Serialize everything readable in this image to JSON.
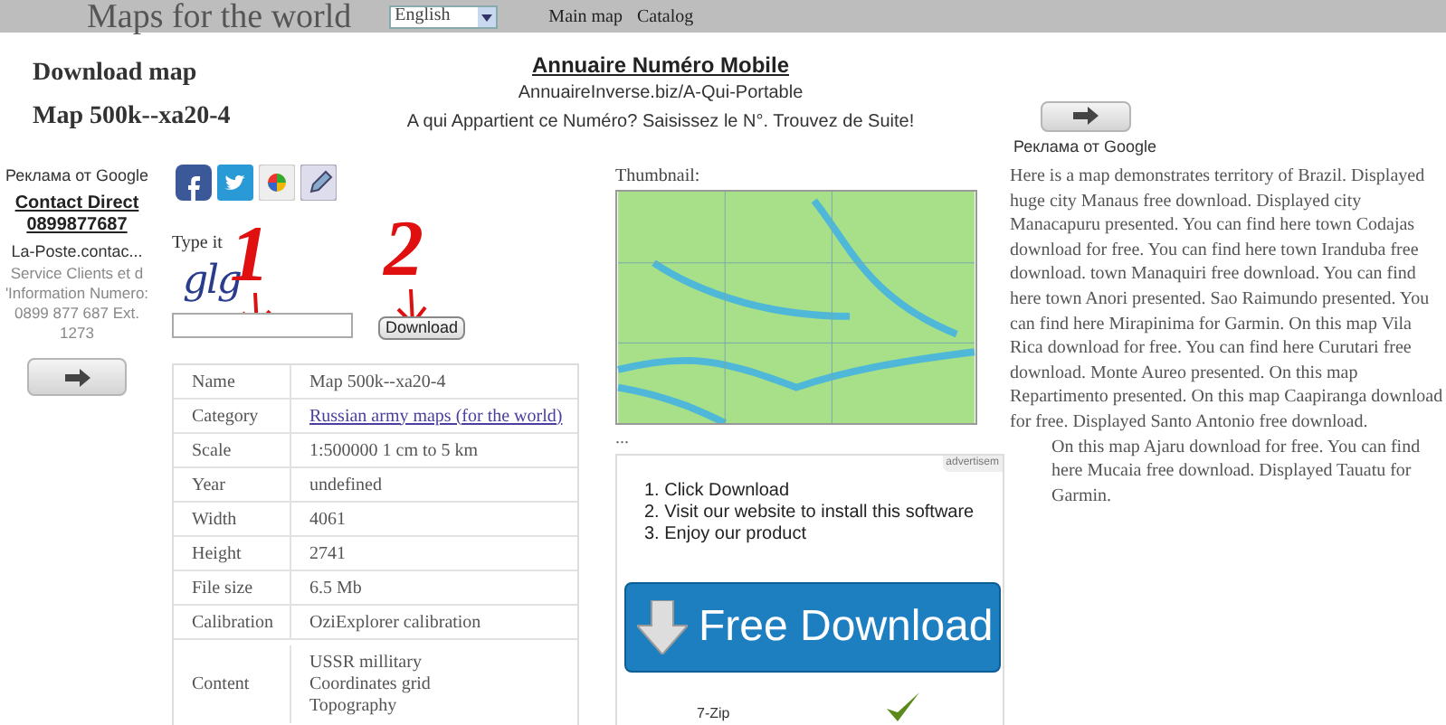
{
  "header": {
    "title": "Maps for the world",
    "language": "English",
    "nav": [
      "Main map",
      "Catalog"
    ]
  },
  "heading": {
    "title": "Download map",
    "subtitle": "Map 500k--xa20-4"
  },
  "top_ad": {
    "title": "Annuaire Numéro Mobile",
    "url": "AnnuaireInverse.biz/A-Qui-Portable",
    "text": "A qui Appartient ce Numéro? Saisissez le N°. Trouvez de Suite!",
    "ad_label": "Реклама от Google"
  },
  "side_ad": {
    "ad_label": "Реклама от Google",
    "title": "Contact Direct 0899877687",
    "subtitle": "La-Poste.contac...",
    "text": "Service Clients et d 'Information Numero: 0899 877 687 Ext. 1273"
  },
  "captcha": {
    "label": "Type it",
    "code": "glg",
    "marks": [
      "1",
      "2"
    ],
    "button": "Download"
  },
  "details": [
    {
      "label": "Name",
      "value": "Map 500k--xa20-4",
      "kind": "text"
    },
    {
      "label": "Category",
      "value": "Russian army maps (for the world)",
      "kind": "link"
    },
    {
      "label": "Scale",
      "value": "1:500000 1 cm to 5 km",
      "kind": "text"
    },
    {
      "label": "Year",
      "value": "undefined",
      "kind": "text"
    },
    {
      "label": "Width",
      "value": "4061",
      "kind": "text"
    },
    {
      "label": "Height",
      "value": "2741",
      "kind": "text"
    },
    {
      "label": "File size",
      "value": "6.5 Mb",
      "kind": "text"
    },
    {
      "label": "Calibration",
      "value": "OziExplorer calibration",
      "kind": "text"
    },
    {
      "label": "Content",
      "value": [
        "USSR millitary",
        "Coordinates grid",
        "Topography"
      ],
      "kind": "list"
    }
  ],
  "thumbnail": {
    "label": "Thumbnail:",
    "more": "..."
  },
  "download_ad": {
    "badge": "advertisem",
    "steps": [
      "1. Click Download",
      "2. Visit our website to install this software",
      "3. Enjoy our product"
    ],
    "button": "Free Download",
    "item": "7-Zip"
  },
  "description": [
    "Here is a map demonstrates territory of Brazil. Displayed huge city Manaus free download. Displayed city Manacapuru presented. You can find here town Codajas download for free. You can find here town Iranduba free download. town Manaquiri free download. You can find here town Anori presented. Sao Raimundo presented. You can find here Mirapinima for Garmin. On this map Vila Rica download for free. You can find here Curutari free download. Monte Aureo presented. On this map Repartimento presented. On this map Caapiranga download for free. Displayed Santo Antonio free download.",
    "On this map Ajaru download for free. You can find here Mucaia free download. Displayed Tauatu for Garmin."
  ]
}
